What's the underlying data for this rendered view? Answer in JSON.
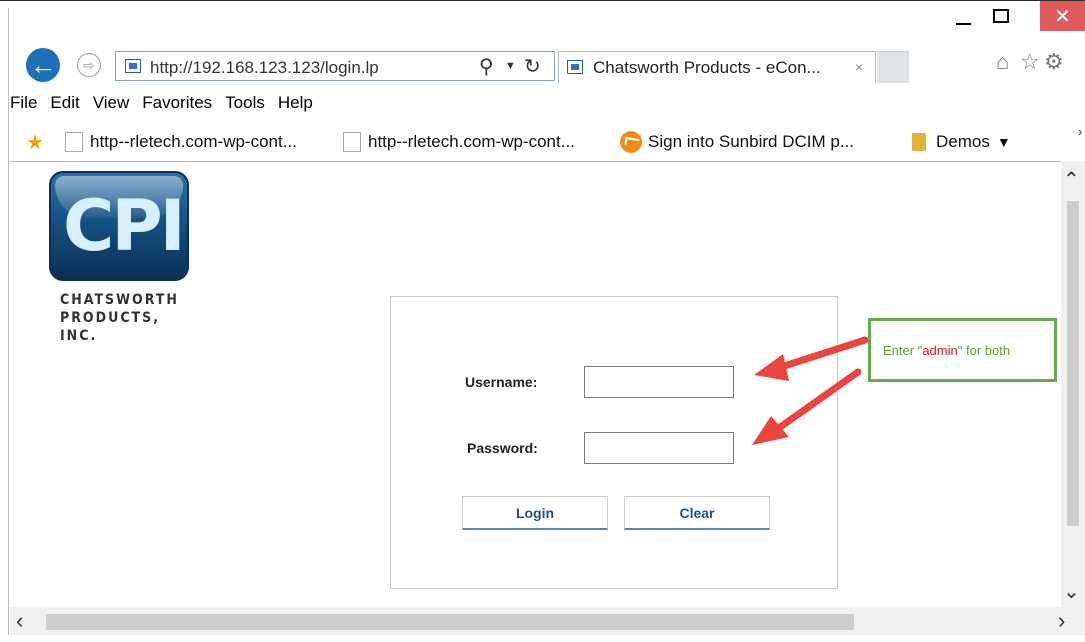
{
  "window": {
    "minimize": "_",
    "close": "✕"
  },
  "navbar": {
    "address": "http://192.168.123.123/login.lp",
    "tab_title": "Chatsworth Products - eCon...",
    "tab_close": "×"
  },
  "menu": {
    "items": [
      "File",
      "Edit",
      "View",
      "Favorites",
      "Tools",
      "Help"
    ]
  },
  "favorites": {
    "items": [
      {
        "label": "http--rletech.com-wp-cont..."
      },
      {
        "label": "http--rletech.com-wp-cont..."
      },
      {
        "label": "Sign into  Sunbird DCIM p..."
      },
      {
        "label": "Demos"
      }
    ]
  },
  "page": {
    "logo_letters": "CPI",
    "company_line1": "CHATSWORTH",
    "company_line2": "PRODUCTS, INC.",
    "username_label": "Username:",
    "password_label": "Password:",
    "username_value": "",
    "password_value": "",
    "login_label": "Login",
    "clear_label": "Clear"
  },
  "callout": {
    "text_before": "Enter \"",
    "text_highlight": "admin",
    "text_after": "\" for both"
  },
  "colors": {
    "close_button": "#e05b5b",
    "back_button": "#1d6fb8",
    "callout_border": "#6aa84f",
    "callout_text": "#5aa02c",
    "callout_highlight": "#e0161b",
    "arrow": "#e8463f"
  }
}
